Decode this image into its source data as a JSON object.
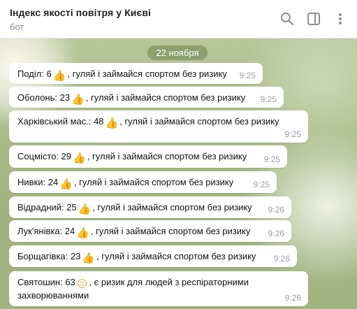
{
  "header": {
    "title": "Індекс якості повітря у Києві",
    "subtitle": "бот",
    "icons": [
      "search-icon",
      "sidebar-toggle-icon",
      "more-vertical-icon"
    ]
  },
  "chat": {
    "date": "22 ноября",
    "messages": [
      {
        "prefix": "Поділ: 6",
        "emoji": "👍",
        "text": ", гуляй і займайся спортом без ризику",
        "time": "9:25"
      },
      {
        "prefix": "Оболонь: 23",
        "emoji": "👍",
        "text": ", гуляй і займайся спортом без ризику",
        "time": "9:25"
      },
      {
        "prefix": "Харківський мас.: 48",
        "emoji": "👍",
        "text": ", гуляй і займайся спортом без ризику",
        "time": "9:25"
      },
      {
        "prefix": "Соцмісто: 29",
        "emoji": "👍",
        "text": ", гуляй і займайся спортом без ризику",
        "time": "9:25"
      },
      {
        "prefix": "Нивки: 24",
        "emoji": "👍",
        "text": ", гуляй і займайся спортом без ризику",
        "time": "9:25"
      },
      {
        "prefix": "Відрадний: 25",
        "emoji": "👍",
        "text": ", гуляй і займайся спортом без ризику",
        "time": "9:26"
      },
      {
        "prefix": "Лук'янівка: 24",
        "emoji": "👍",
        "text": ", гуляй і займайся спортом без ризику",
        "time": "9:26"
      },
      {
        "prefix": "Борщагівка: 23",
        "emoji": "👍",
        "text": ", гуляй і займайся спортом без ризику",
        "time": "9:26"
      },
      {
        "prefix": "Святошин: 63",
        "emoji": "😐",
        "text": ", є ризик для людей з респіраторними",
        "text2": "захворюваннями",
        "time": "9:26"
      }
    ]
  }
}
